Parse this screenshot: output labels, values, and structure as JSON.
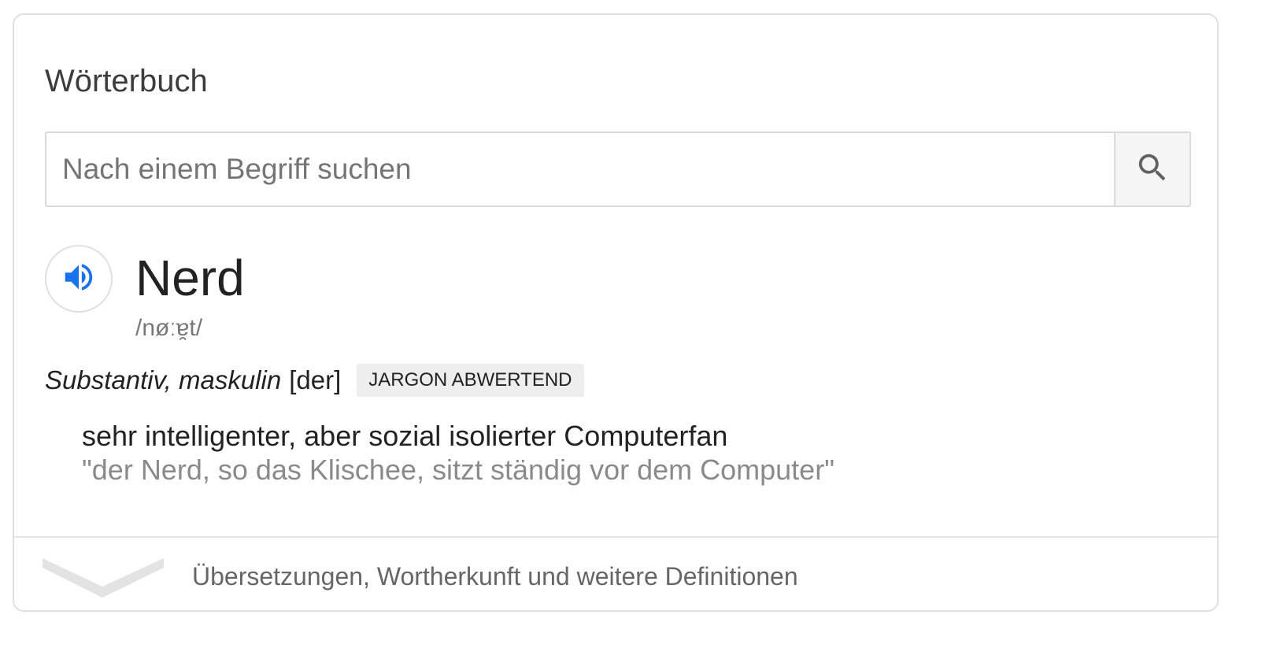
{
  "card": {
    "title": "Wörterbuch"
  },
  "search": {
    "placeholder": "Nach einem Begriff suchen",
    "value": "",
    "button_icon": "search-icon"
  },
  "entry": {
    "audio_icon": "speaker-icon",
    "headword": "Nerd",
    "phonetic": "/nøːɐ̯t/",
    "part_of_speech": "Substantiv, maskulin",
    "gender": "[der]",
    "tag": "JARGON ABWERTEND",
    "definition": "sehr intelligenter, aber sozial isolierter Computerfan",
    "example": "\"der Nerd, so das Klischee, sitzt ständig vor dem Computer\""
  },
  "footer": {
    "expand_icon": "chevron-down-icon",
    "label": "Übersetzungen, Wortherkunft und weitere Definitionen"
  },
  "colors": {
    "accent": "#1a73e8",
    "border": "#e0e0e0",
    "text_primary": "#222222",
    "text_secondary": "#777777"
  }
}
